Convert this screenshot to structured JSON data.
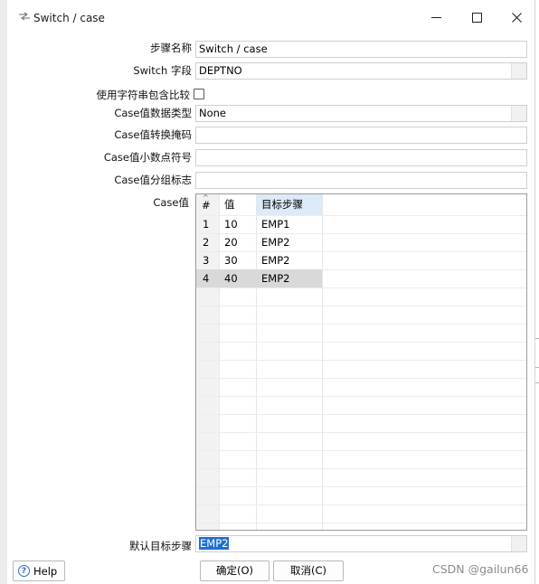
{
  "window": {
    "title": "Switch / case",
    "minimize": "—",
    "maximize": "☐",
    "close": "✕"
  },
  "form": {
    "step_name_label": "步骤名称",
    "step_name_value": "Switch / case",
    "switch_field_label": "Switch 字段",
    "switch_field_value": "DEPTNO",
    "use_contains_label": "使用字符串包含比较",
    "use_contains_checked": false,
    "case_data_type_label": "Case值数据类型",
    "case_data_type_value": "None",
    "case_conversion_mask_label": "Case值转换掩码",
    "case_conversion_mask_value": "",
    "case_decimal_symbol_label": "Case值小数点符号",
    "case_decimal_symbol_value": "",
    "case_grouping_symbol_label": "Case值分组标志",
    "case_grouping_symbol_value": "",
    "case_values_label": "Case值",
    "default_target_label": "默认目标步骤",
    "default_target_value": "EMP2"
  },
  "table": {
    "columns": [
      "#",
      "值",
      "目标步骤"
    ],
    "rows": [
      {
        "num": "1",
        "value": "10",
        "target": "EMP1"
      },
      {
        "num": "2",
        "value": "20",
        "target": "EMP2"
      },
      {
        "num": "3",
        "value": "30",
        "target": "EMP2"
      },
      {
        "num": "4",
        "value": "40",
        "target": "EMP2"
      }
    ],
    "selected_row": 4
  },
  "buttons": {
    "help": "Help",
    "ok": "确定(O)",
    "cancel": "取消(C)"
  },
  "watermark": "CSDN @gailun66",
  "colors": {
    "selection": "#1f6fcf",
    "header_highlight": "#dcebf7",
    "selected_row": "#d9d9d9"
  }
}
